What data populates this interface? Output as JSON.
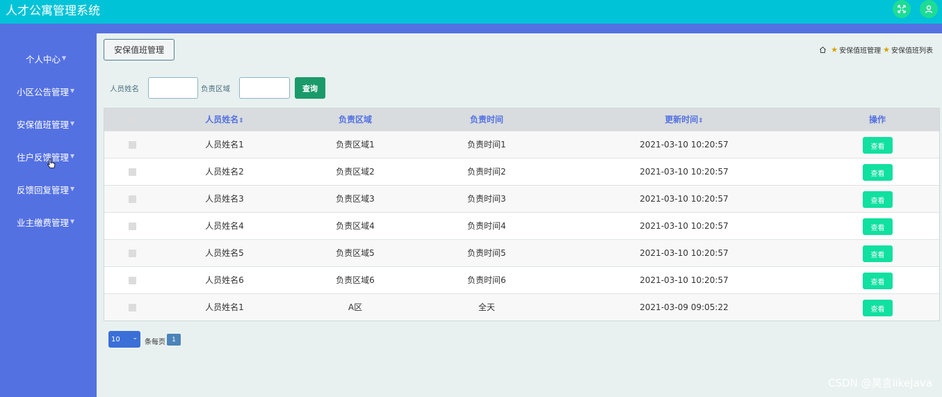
{
  "app": {
    "title": "人才公寓管理系统"
  },
  "topbar": {
    "icons": [
      "expand-icon",
      "user-icon"
    ]
  },
  "sidebar": {
    "items": [
      {
        "label": "个人中心"
      },
      {
        "label": "小区公告管理"
      },
      {
        "label": "安保值班管理"
      },
      {
        "label": "住户反馈管理"
      },
      {
        "label": "反馈回复管理"
      },
      {
        "label": "业主缴费管理"
      }
    ]
  },
  "page": {
    "tab_label": "安保值班管理"
  },
  "breadcrumb": {
    "items": [
      "安保值班管理",
      "安保值班列表"
    ]
  },
  "search": {
    "name_label": "人员姓名",
    "name_value": "",
    "area_label": "负责区域",
    "area_value": "",
    "query_label": "查询"
  },
  "table": {
    "headers": [
      "人员姓名",
      "负责区域",
      "负责时间",
      "更新时间",
      "操作"
    ],
    "sortable_marker": "⇕",
    "action_label": "查看",
    "rows": [
      {
        "name": "人员姓名1",
        "area": "负责区域1",
        "time": "负责时间1",
        "updated": "2021-03-10 10:20:57"
      },
      {
        "name": "人员姓名2",
        "area": "负责区域2",
        "time": "负责时间2",
        "updated": "2021-03-10 10:20:57"
      },
      {
        "name": "人员姓名3",
        "area": "负责区域3",
        "time": "负责时间3",
        "updated": "2021-03-10 10:20:57"
      },
      {
        "name": "人员姓名4",
        "area": "负责区域4",
        "time": "负责时间4",
        "updated": "2021-03-10 10:20:57"
      },
      {
        "name": "人员姓名5",
        "area": "负责区域5",
        "time": "负责时间5",
        "updated": "2021-03-10 10:20:57"
      },
      {
        "name": "人员姓名6",
        "area": "负责区域6",
        "time": "负责时间6",
        "updated": "2021-03-10 10:20:57"
      },
      {
        "name": "人员姓名1",
        "area": "A区",
        "time": "全天",
        "updated": "2021-03-09 09:05:22"
      }
    ]
  },
  "pagination": {
    "page_size": "10",
    "per_page_label": "条每页",
    "current_page": "1"
  },
  "watermark": "CSDN @昊言likeJava",
  "colors": {
    "header": "#00c3d8",
    "sidebar": "#5471e2",
    "action": "#10e0a0",
    "query": "#1a9a6a"
  }
}
